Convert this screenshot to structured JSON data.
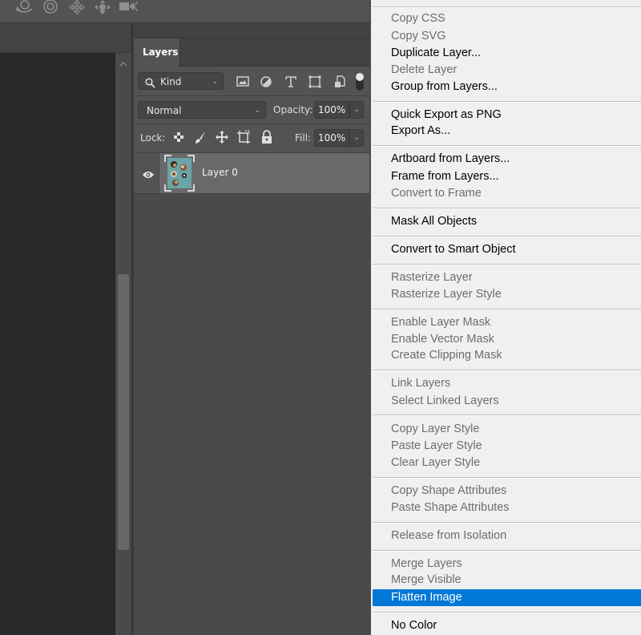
{
  "toolbar": {
    "icons": [
      "orbit-3d-icon",
      "roll-3d-icon",
      "drag-3d-icon",
      "slide-3d-icon",
      "scale-3d-video-icon"
    ]
  },
  "layers_panel": {
    "tab_label": "Layers",
    "filter": {
      "kind_label": "Kind",
      "filter_icons": [
        "pixel-layer-filter-icon",
        "adjustment-layer-filter-icon",
        "type-layer-filter-icon",
        "shape-layer-filter-icon",
        "smart-object-filter-icon",
        "filter-toggle-icon"
      ]
    },
    "blend_mode": "Normal",
    "opacity_label": "Opacity:",
    "opacity_value": "100%",
    "lock_label": "Lock:",
    "lock_icons": [
      "lock-transparent-pixels-icon",
      "lock-image-pixels-icon",
      "lock-position-icon",
      "lock-artboard-icon",
      "lock-all-icon"
    ],
    "fill_label": "Fill:",
    "fill_value": "100%",
    "layers": [
      {
        "name": "Layer 0",
        "visible": true
      }
    ]
  },
  "context_menu": {
    "groups": [
      [
        {
          "label": "Copy CSS",
          "enabled": false
        },
        {
          "label": "Copy SVG",
          "enabled": false
        },
        {
          "label": "Duplicate Layer...",
          "enabled": true
        },
        {
          "label": "Delete Layer",
          "enabled": false
        },
        {
          "label": "Group from Layers...",
          "enabled": true
        }
      ],
      [
        {
          "label": "Quick Export as PNG",
          "enabled": true
        },
        {
          "label": "Export As...",
          "enabled": true
        }
      ],
      [
        {
          "label": "Artboard from Layers...",
          "enabled": true
        },
        {
          "label": "Frame from Layers...",
          "enabled": true
        },
        {
          "label": "Convert to Frame",
          "enabled": false
        }
      ],
      [
        {
          "label": "Mask All Objects",
          "enabled": true
        }
      ],
      [
        {
          "label": "Convert to Smart Object",
          "enabled": true
        }
      ],
      [
        {
          "label": "Rasterize Layer",
          "enabled": false
        },
        {
          "label": "Rasterize Layer Style",
          "enabled": false
        }
      ],
      [
        {
          "label": "Enable Layer Mask",
          "enabled": false
        },
        {
          "label": "Enable Vector Mask",
          "enabled": false
        },
        {
          "label": "Create Clipping Mask",
          "enabled": false
        }
      ],
      [
        {
          "label": "Link Layers",
          "enabled": false
        },
        {
          "label": "Select Linked Layers",
          "enabled": false
        }
      ],
      [
        {
          "label": "Copy Layer Style",
          "enabled": false
        },
        {
          "label": "Paste Layer Style",
          "enabled": false
        },
        {
          "label": "Clear Layer Style",
          "enabled": false
        }
      ],
      [
        {
          "label": "Copy Shape Attributes",
          "enabled": false
        },
        {
          "label": "Paste Shape Attributes",
          "enabled": false
        }
      ],
      [
        {
          "label": "Release from Isolation",
          "enabled": false
        }
      ],
      [
        {
          "label": "Merge Layers",
          "enabled": false
        },
        {
          "label": "Merge Visible",
          "enabled": false
        },
        {
          "label": "Flatten Image",
          "enabled": true,
          "highlighted": true
        }
      ],
      [
        {
          "label": "No Color",
          "enabled": true
        }
      ]
    ],
    "highlight_color": "#0078d7"
  }
}
